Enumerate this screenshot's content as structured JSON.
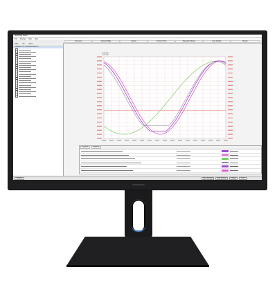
{
  "app": {
    "title": "SMARTlog Viewer",
    "menu": [
      "File",
      "Settings",
      "View",
      "Help"
    ]
  },
  "tabs": [
    "Overview",
    "Channel Table",
    "Custom",
    "Compare Plots",
    "Waveform History",
    "Sum Graphs",
    "Report"
  ],
  "active_tab_index": 3,
  "left_panel": {
    "headers": [
      "Table",
      "Ch",
      "Value"
    ],
    "selected_item": "Waveform 17.0.60.66.64.46.12.3"
  },
  "bottom_buttons": {
    "left": "Settings",
    "right": [
      "Save Settings",
      "Load Settings",
      "Update",
      "Help"
    ]
  },
  "legend": {
    "tabs": [
      "Legend",
      "Options"
    ]
  },
  "colors": {
    "bezel": "#1f1f21",
    "series_purple": "#a24bd1",
    "series_pink": "#e15ad0",
    "series_green": "#7ccb64",
    "series_gray": "#8c8aa0",
    "ref_line": "#e05050",
    "grid": "#e9c9c9"
  }
}
